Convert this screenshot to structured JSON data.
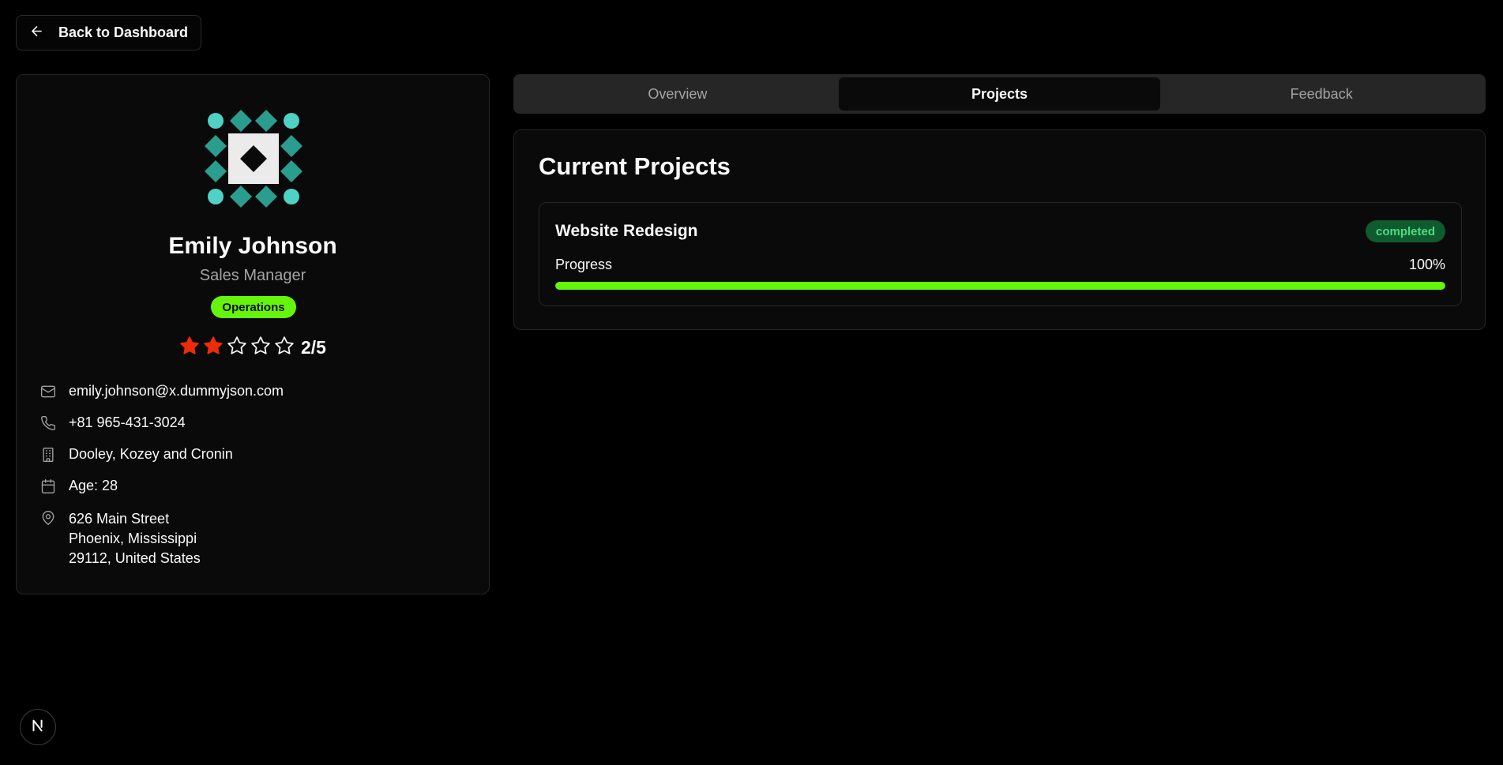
{
  "nav": {
    "back_label": "Back to Dashboard"
  },
  "profile": {
    "name": "Emily Johnson",
    "title": "Sales Manager",
    "department": "Operations",
    "rating": {
      "value": 2,
      "max": 5,
      "text": "2/5"
    },
    "email": "emily.johnson@x.dummyjson.com",
    "phone": "+81 965-431-3024",
    "company": "Dooley, Kozey and Cronin",
    "age": "Age: 28",
    "address": {
      "line1": "626 Main Street",
      "line2": "Phoenix, Mississippi",
      "line3": "29112, United States"
    }
  },
  "tabs": [
    {
      "label": "Overview",
      "active": false
    },
    {
      "label": "Projects",
      "active": true
    },
    {
      "label": "Feedback",
      "active": false
    }
  ],
  "projects": {
    "title": "Current Projects",
    "items": [
      {
        "name": "Website Redesign",
        "status": "completed",
        "progress_label": "Progress",
        "progress_text": "100%",
        "progress": 100
      }
    ]
  },
  "colors": {
    "accent": "#65f50a",
    "star": "#ef2b0a",
    "avatar_teal": "#2a9d8f",
    "avatar_light": "#4fd1c5",
    "status_bg": "#0f5a2f",
    "status_text": "#4ade80"
  },
  "icons": [
    "arrow-left-icon",
    "mail-icon",
    "phone-icon",
    "building-icon",
    "calendar-icon",
    "map-pin-icon",
    "star-icon",
    "next-logo-icon"
  ]
}
